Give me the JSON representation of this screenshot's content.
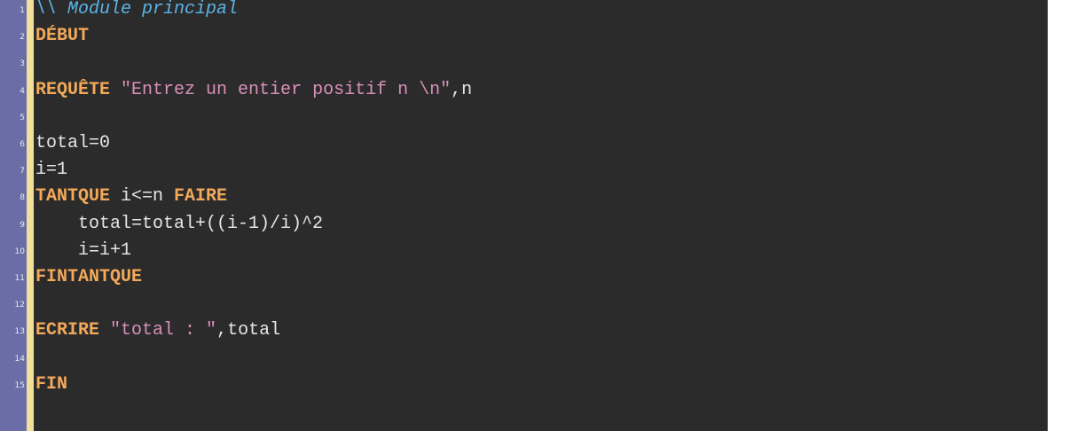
{
  "lines": [
    {
      "num": "1",
      "segments": [
        {
          "cls": "comment",
          "text": "\\\\ Module principal"
        }
      ]
    },
    {
      "num": "2",
      "segments": [
        {
          "cls": "kw",
          "text": "DÉBUT"
        }
      ]
    },
    {
      "num": "3",
      "segments": []
    },
    {
      "num": "4",
      "segments": [
        {
          "cls": "kw",
          "text": "REQUÊTE"
        },
        {
          "cls": "plain",
          "text": " "
        },
        {
          "cls": "str",
          "text": "\"Entrez un entier positif n \\n\""
        },
        {
          "cls": "plain",
          "text": ",n"
        }
      ]
    },
    {
      "num": "5",
      "segments": []
    },
    {
      "num": "6",
      "segments": [
        {
          "cls": "plain",
          "text": "total=0"
        }
      ]
    },
    {
      "num": "7",
      "segments": [
        {
          "cls": "plain",
          "text": "i=1"
        }
      ]
    },
    {
      "num": "8",
      "segments": [
        {
          "cls": "kw",
          "text": "TANTQUE"
        },
        {
          "cls": "plain",
          "text": " i<=n "
        },
        {
          "cls": "kw",
          "text": "FAIRE"
        }
      ]
    },
    {
      "num": "9",
      "segments": [
        {
          "cls": "plain",
          "text": "    total=total+((i-1)/i)^2"
        }
      ]
    },
    {
      "num": "10",
      "segments": [
        {
          "cls": "plain",
          "text": "    i=i+1"
        }
      ]
    },
    {
      "num": "11",
      "segments": [
        {
          "cls": "kw",
          "text": "FINTANTQUE"
        }
      ]
    },
    {
      "num": "12",
      "segments": []
    },
    {
      "num": "13",
      "segments": [
        {
          "cls": "kw",
          "text": "ECRIRE"
        },
        {
          "cls": "plain",
          "text": " "
        },
        {
          "cls": "str",
          "text": "\"total : \""
        },
        {
          "cls": "plain",
          "text": ",total"
        }
      ]
    },
    {
      "num": "14",
      "segments": []
    },
    {
      "num": "15",
      "segments": [
        {
          "cls": "kw",
          "text": "FIN"
        }
      ]
    }
  ],
  "colors": {
    "background": "#2b2b2b",
    "gutter": "#6b6ea6",
    "margin_strip": "#f3df9c",
    "keyword": "#f3a95a",
    "string": "#d98fb8",
    "comment": "#5ab4e6",
    "text": "#e6e6e6"
  }
}
